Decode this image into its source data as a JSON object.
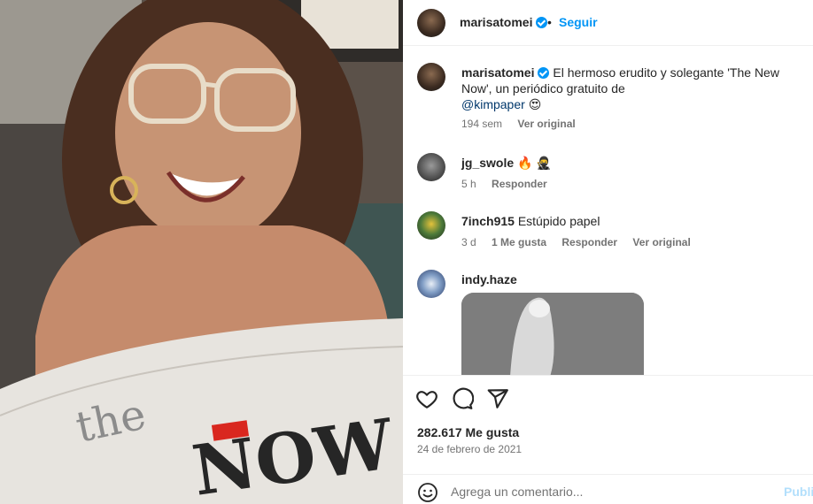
{
  "post": {
    "username": "marisatomei",
    "follow_label": "Seguir",
    "caption_text": "El hermoso erudito y solegante 'The New Now', un periódico gratuito de",
    "caption_mention": "@kimpaper",
    "caption_emoji": "😍",
    "caption_age": "194 sem",
    "caption_see_original": "Ver original",
    "likes": "282.617 Me gusta",
    "date": "24 de febrero de 2021"
  },
  "comments": [
    {
      "username": "jg_swole",
      "text": "🔥 🥷",
      "age": "5 h",
      "reply": "Responder"
    },
    {
      "username": "7inch915",
      "text": "Estúpido papel",
      "age": "3 d",
      "likes": "1 Me gusta",
      "reply": "Responder",
      "see_original": "Ver original"
    },
    {
      "username": "indy.haze"
    }
  ],
  "composer": {
    "placeholder": "Agrega un comentario...",
    "publish_label": "Publi"
  },
  "newspaper": {
    "masthead_small": "the",
    "masthead_large": "NOW"
  },
  "icons": {
    "like": "heart-icon",
    "comment": "comment-bubble-icon",
    "share": "paper-plane-icon",
    "emoji": "emoji-smile-icon",
    "verified": "verified-badge-icon"
  },
  "colors": {
    "accent": "#0095f6",
    "verified": "#0095f6",
    "meta_text": "#737373",
    "mention": "#00376b"
  }
}
